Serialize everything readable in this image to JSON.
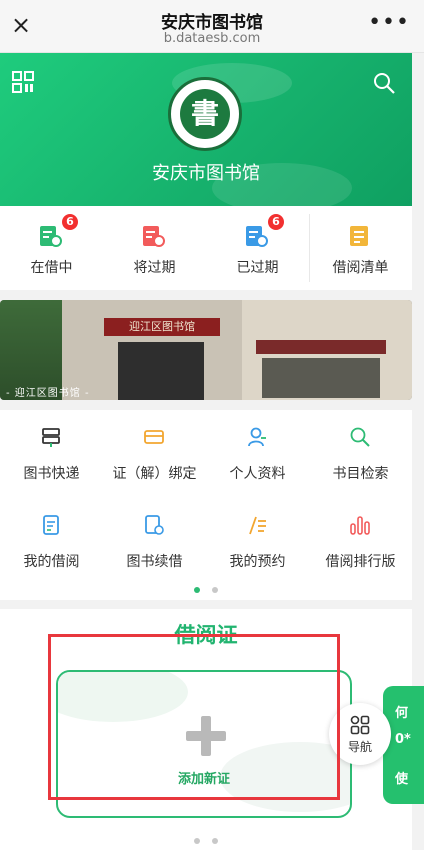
{
  "topbar": {
    "title": "安庆市图书馆",
    "url": "b.dataesb.com",
    "close_glyph": "×",
    "more_glyph": "•••"
  },
  "hero": {
    "library_name": "安庆市图书馆",
    "logo_char": "書",
    "qr_icon": "qr-icon",
    "search_icon": "search-icon",
    "accent": "#1fcc7d"
  },
  "tabs": [
    {
      "label": "在借中",
      "badge": "6",
      "icon": "book-clock-icon",
      "color": "#2dbb74"
    },
    {
      "label": "将过期",
      "badge": "",
      "icon": "book-warn-icon",
      "color": "#f25b5b"
    },
    {
      "label": "已过期",
      "badge": "6",
      "icon": "book-check-icon",
      "color": "#3a9ae6"
    },
    {
      "label": "借阅清单",
      "badge": "",
      "icon": "list-icon",
      "color": "#f2b63a"
    }
  ],
  "banner": {
    "sign_text": "迎江区图书馆",
    "caption": "- 迎江区图书馆 -"
  },
  "grid": [
    {
      "label": "图书快递",
      "icon": "delivery-icon"
    },
    {
      "label": "证（解）绑定",
      "icon": "card-icon"
    },
    {
      "label": "个人资料",
      "icon": "person-icon"
    },
    {
      "label": "书目检索",
      "icon": "search-icon"
    },
    {
      "label": "我的借阅",
      "icon": "my-borrow-icon"
    },
    {
      "label": "图书续借",
      "icon": "renew-icon"
    },
    {
      "label": "我的预约",
      "icon": "reserve-icon"
    },
    {
      "label": "借阅排行版",
      "icon": "rank-icon"
    }
  ],
  "cards": {
    "section_title": "借阅证",
    "add_label": "添加新证",
    "side_card_lines": [
      "何",
      "0*",
      "使"
    ],
    "nav_label": "导航"
  },
  "colors": {
    "green": "#2dbb74",
    "red_box": "#e8373d",
    "badge": "#f23030"
  }
}
